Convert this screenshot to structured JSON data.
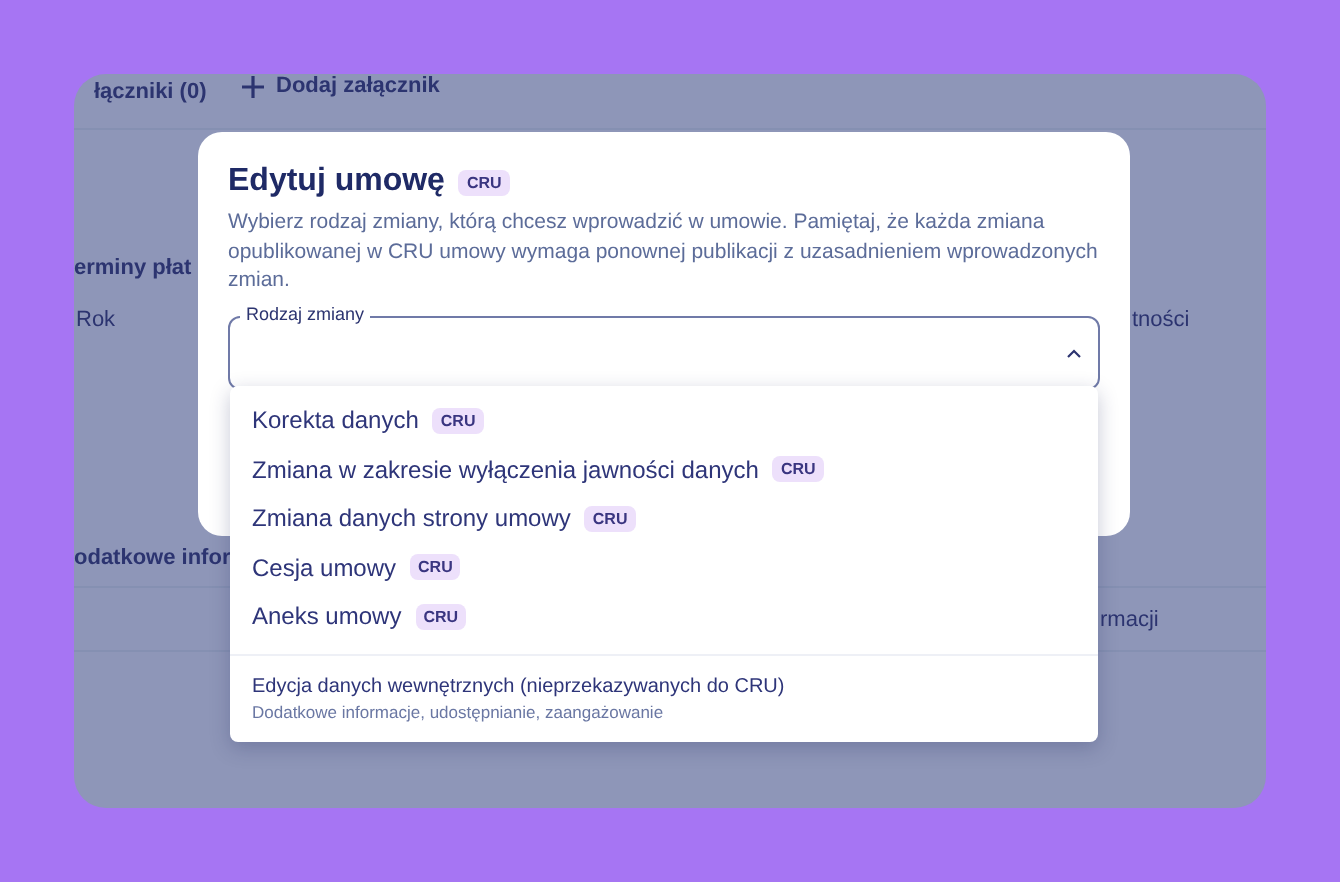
{
  "background": {
    "attachments_heading": "łączniki (0)",
    "add_attachment": "Dodaj załącznik",
    "section_1": "erminy płat",
    "column_1": "Rok",
    "column_2": "tności",
    "section_2": "odatkowe infor",
    "column_3": "rmacji"
  },
  "dialog": {
    "title": "Edytuj umowę",
    "badge": "CRU",
    "description": "Wybierz rodzaj zmiany, którą chcesz wprowadzić w umowie. Pamiętaj, że każda zmiana opublikowanej w CRU umowy wymaga ponownej publikacji z uzasadnieniem wprowadzonych zmian.",
    "field": {
      "label": "Rodzaj zmiany",
      "expanded": true
    }
  },
  "dropdown": {
    "options": [
      {
        "label": "Korekta danych",
        "badge": "CRU"
      },
      {
        "label": "Zmiana w zakresie wyłączenia jawności danych",
        "badge": "CRU"
      },
      {
        "label": "Zmiana danych strony umowy",
        "badge": "CRU"
      },
      {
        "label": "Cesja umowy",
        "badge": "CRU"
      },
      {
        "label": "Aneks umowy",
        "badge": "CRU"
      }
    ],
    "internal_option": {
      "label": "Edycja danych wewnętrznych (nieprzekazywanych do CRU)",
      "sublabel": "Dodatkowe informacje, udostępnianie, zaangażowanie"
    }
  }
}
